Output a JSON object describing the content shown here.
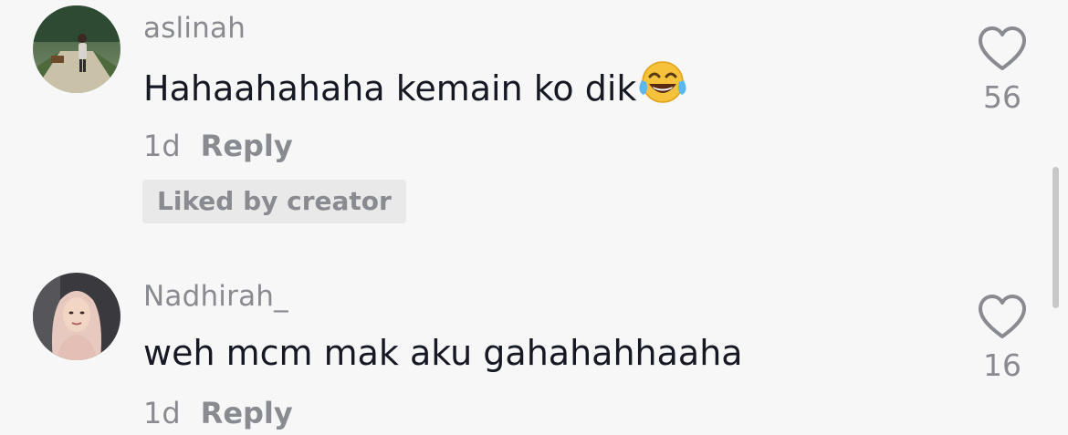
{
  "comments": [
    {
      "username": "aslinah",
      "text": "Hahaahahaha kemain ko dik",
      "emoji_icon": "face-with-tears-of-joy-icon",
      "time": "1d",
      "reply_label": "Reply",
      "badge": "Liked by creator",
      "likes": "56"
    },
    {
      "username": "Nadhirah_",
      "text": "weh mcm mak aku gahahahhaaha",
      "time": "1d",
      "reply_label": "Reply",
      "likes": "16"
    }
  ],
  "colors": {
    "background": "#f7f7f7",
    "primary_text": "#161823",
    "secondary_text": "#8a8b91",
    "badge_bg": "#e9e9ea"
  }
}
